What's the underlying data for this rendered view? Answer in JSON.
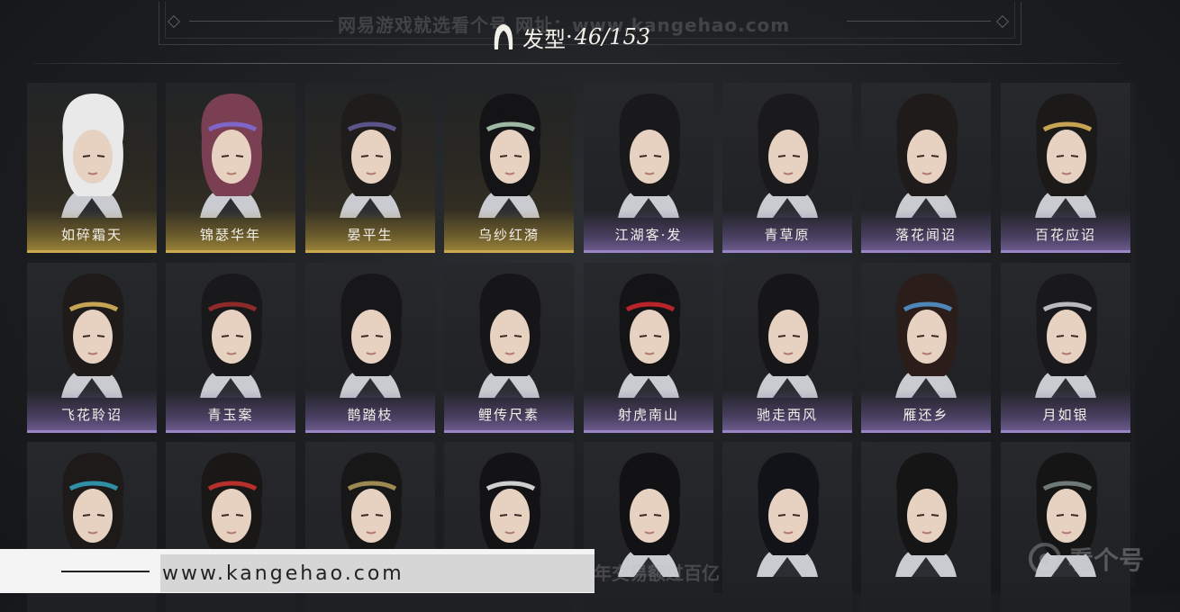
{
  "header": {
    "title": "发型",
    "separator": "·",
    "count": "46/153",
    "watermark": "网易游戏就选看个号  网址：www.kangehao.com"
  },
  "colors": {
    "gold_rarity": "#c9a94e",
    "purple_rarity": "#9a86c4",
    "background": "#1c1e21"
  },
  "hairstyles": [
    {
      "name": "如碎霜天",
      "rarity": "gold",
      "hair": "#e9e9ea",
      "accent": ""
    },
    {
      "name": "锦瑟华年",
      "rarity": "gold",
      "hair": "#7a3f52",
      "accent": "#7e66c8"
    },
    {
      "name": "晏平生",
      "rarity": "gold",
      "hair": "#1f1c1c",
      "accent": "#5a5488"
    },
    {
      "name": "乌纱红漪",
      "rarity": "gold",
      "hair": "#141416",
      "accent": "#9fb8a4"
    },
    {
      "name": "江湖客·发",
      "rarity": "purple",
      "hair": "#19191b",
      "accent": ""
    },
    {
      "name": "青草原",
      "rarity": "purple",
      "hair": "#1a1a1c",
      "accent": ""
    },
    {
      "name": "落花闻诏",
      "rarity": "purple",
      "hair": "#1e1b1a",
      "accent": ""
    },
    {
      "name": "百花应诏",
      "rarity": "purple",
      "hair": "#1c1a19",
      "accent": "#c6a453"
    },
    {
      "name": "飞花聆诏",
      "rarity": "purple",
      "hair": "#1e1b1a",
      "accent": "#c6a453"
    },
    {
      "name": "青玉案",
      "rarity": "purple",
      "hair": "#19191b",
      "accent": "#8e2a2a"
    },
    {
      "name": "鹊踏枝",
      "rarity": "purple",
      "hair": "#171719",
      "accent": ""
    },
    {
      "name": "鲤传尺素",
      "rarity": "purple",
      "hair": "#161618",
      "accent": ""
    },
    {
      "name": "射虎南山",
      "rarity": "purple",
      "hair": "#141416",
      "accent": "#b8242a"
    },
    {
      "name": "驰走西风",
      "rarity": "purple",
      "hair": "#161618",
      "accent": ""
    },
    {
      "name": "雁还乡",
      "rarity": "purple",
      "hair": "#2a1d1a",
      "accent": "#4e86b8"
    },
    {
      "name": "月如银",
      "rarity": "purple",
      "hair": "#19191b",
      "accent": "#b9b9bf"
    },
    {
      "name": "",
      "rarity": "none",
      "hair": "#1d1a19",
      "accent": "#2e8fa6"
    },
    {
      "name": "",
      "rarity": "none",
      "hair": "#1a1817",
      "accent": "#b8302c"
    },
    {
      "name": "",
      "rarity": "none",
      "hair": "#171718",
      "accent": "#9c8a52"
    },
    {
      "name": "",
      "rarity": "none",
      "hair": "#131315",
      "accent": "#cfcfcf"
    },
    {
      "name": "",
      "rarity": "none",
      "hair": "#121214",
      "accent": ""
    },
    {
      "name": "",
      "rarity": "none",
      "hair": "#121318",
      "accent": ""
    },
    {
      "name": "",
      "rarity": "none",
      "hair": "#151516",
      "accent": ""
    },
    {
      "name": "",
      "rarity": "none",
      "hair": "#151516",
      "accent": "#6f7a78"
    }
  ],
  "footer": {
    "site": "www.kangehao.com",
    "watermark": "看个号专业网易游戏八年  年交易额过百亿",
    "logo_text": "看个号"
  }
}
